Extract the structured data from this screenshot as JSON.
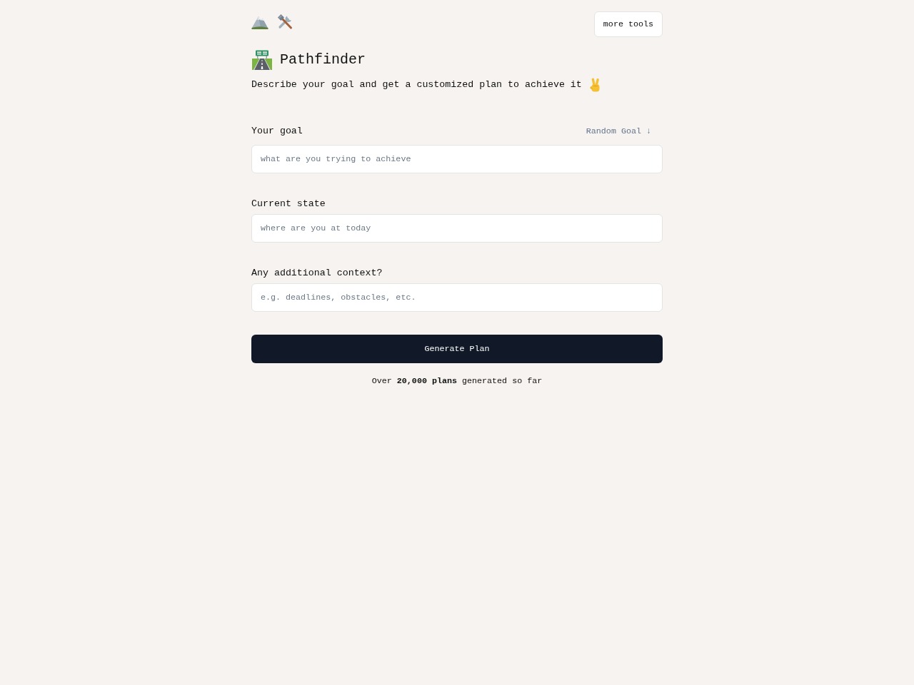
{
  "header": {
    "more_tools_button": "more tools"
  },
  "title": "Pathfinder",
  "subtitle": "Describe your goal and get a customized plan to achieve it",
  "fields": [
    {
      "label": "Your goal",
      "action": "Random Goal ↓",
      "placeholder": "what are you trying to achieve"
    },
    {
      "label": "Current state",
      "placeholder": "where are you at today"
    },
    {
      "label": "Any additional context?",
      "placeholder": "e.g. deadlines, obstacles, etc."
    }
  ],
  "submit_button": "Generate Plan",
  "footer": "Over **20,000 plans** generated so far"
}
